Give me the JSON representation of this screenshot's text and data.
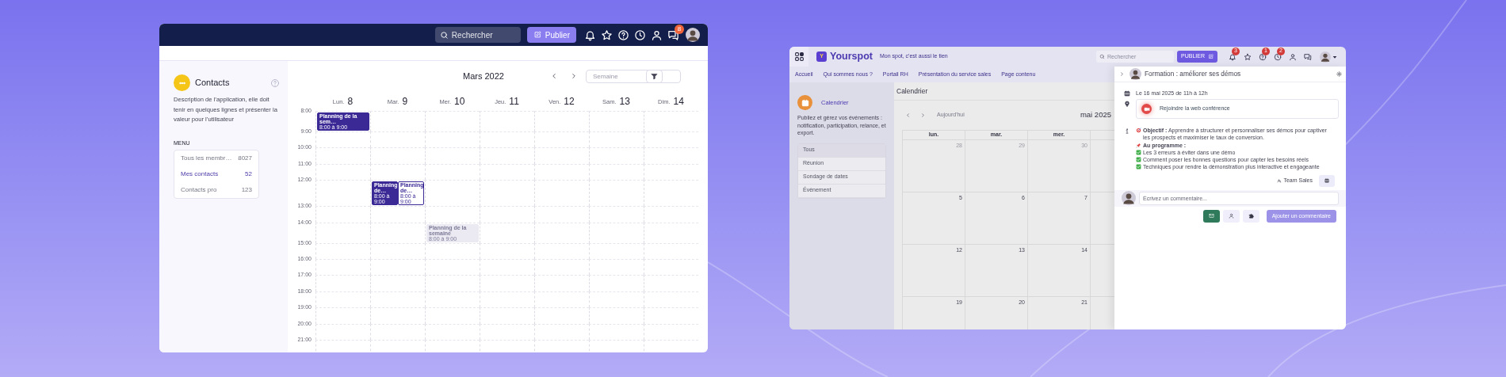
{
  "left_window": {
    "toolbar": [
      {
        "kind": "bell"
      },
      {
        "kind": "star"
      },
      {
        "kind": "help"
      },
      {
        "kind": "clock"
      },
      {
        "kind": "user"
      },
      {
        "kind": "chat",
        "badge": "8"
      }
    ],
    "search_placeholder": "Rechercher",
    "publish_label": "Publier",
    "sidebar": {
      "title": "Contacts",
      "description": "Description de l’application, elle doit tenir en quelques lignes et présenter la valeur pour l’utilisateur",
      "menu_heading": "MENU",
      "menu": [
        {
          "label": "Tous les membr…",
          "count": "8027",
          "selected": false
        },
        {
          "label": "Mes contacts",
          "count": "52",
          "selected": true
        },
        {
          "label": "Contacts pro",
          "count": "123",
          "selected": false
        }
      ]
    },
    "calendar": {
      "title": "Mars 2022",
      "view_placeholder": "Semaine",
      "days": [
        {
          "name": "Lun.",
          "date": "8"
        },
        {
          "name": "Mar.",
          "date": "9"
        },
        {
          "name": "Mer.",
          "date": "10"
        },
        {
          "name": "Jeu.",
          "date": "11"
        },
        {
          "name": "Ven.",
          "date": "12"
        },
        {
          "name": "Sam.",
          "date": "13"
        },
        {
          "name": "Dim.",
          "date": "14"
        }
      ],
      "hours": [
        {
          "label": "8:00",
          "cells": [
            {
              "events": [
                {
                  "kind": "solid",
                  "title": "Planning de la sem…",
                  "time": "8:00 à 9:00"
                }
              ]
            }
          ]
        },
        {
          "label": "9:00"
        },
        {
          "label": "10:00"
        },
        {
          "label": "11:00"
        },
        {
          "label": "12:00",
          "cells": [
            {},
            {
              "events": [
                {
                  "kind": "solid",
                  "title": "Planning de…",
                  "time": "8:00 à 9:00"
                },
                {
                  "kind": "outline",
                  "title": "Planning de…",
                  "time": "8:00 à 9:00"
                }
              ]
            }
          ]
        },
        {
          "label": "13:00"
        },
        {
          "label": "14:00",
          "cells": [
            {},
            {},
            {
              "events": [
                {
                  "kind": "faded",
                  "title": "Planning de la semaine",
                  "time": "8:00 à 9:00"
                }
              ]
            }
          ]
        },
        {
          "label": "15:00"
        },
        {
          "label": "16:00"
        },
        {
          "label": "17:00"
        },
        {
          "label": "18:00"
        },
        {
          "label": "19:00"
        },
        {
          "label": "20:00"
        },
        {
          "label": "21:00"
        }
      ]
    }
  },
  "right_window": {
    "logo_letter": "Y",
    "brand": "Yourspot",
    "tagline": "Mon spot, c'est aussi le tien",
    "search_placeholder": "Rechercher",
    "publish_label": "PUBLIER",
    "toolbar": [
      {
        "kind": "bell",
        "badge": "3"
      },
      {
        "kind": "star"
      },
      {
        "kind": "help",
        "badge": "1"
      },
      {
        "kind": "clock",
        "badge": "2"
      },
      {
        "kind": "user"
      },
      {
        "kind": "chat"
      }
    ],
    "nav": [
      "Accueil",
      "Qui sommes nous ?",
      "Portail RH",
      "Présentation du service sales",
      "Page contenu"
    ],
    "sidebar": {
      "title": "Calendrier",
      "description": "Publiez et gérez vos événements : notification, participation, relance, et export.",
      "filters": [
        {
          "label": "Tous",
          "selected": true
        },
        {
          "label": "Réunion",
          "selected": false
        },
        {
          "label": "Sondage de dates",
          "selected": false
        },
        {
          "label": "Évènement",
          "selected": false
        }
      ]
    },
    "calendar": {
      "heading": "Calendrier",
      "today_label": "Aujourd'hui",
      "title": "mai 2025",
      "weekdays": [
        "lun.",
        "mar.",
        "mer."
      ],
      "weeks": [
        {
          "days": [
            {
              "date": "28",
              "outside": true
            },
            {
              "date": "29",
              "outside": true
            },
            {
              "date": "30",
              "outside": true
            }
          ]
        },
        {
          "days": [
            {
              "date": "5",
              "outside": false
            },
            {
              "date": "6",
              "outside": false
            },
            {
              "date": "7",
              "outside": false
            }
          ]
        },
        {
          "days": [
            {
              "date": "12",
              "outside": false
            },
            {
              "date": "13",
              "outside": false
            },
            {
              "date": "14",
              "outside": false
            }
          ]
        },
        {
          "days": [
            {
              "date": "19",
              "outside": false
            },
            {
              "date": "20",
              "outside": false
            },
            {
              "date": "21",
              "outside": false
            }
          ]
        }
      ]
    },
    "event_panel": {
      "title": "Formation : améliorer ses démos",
      "date": "Le 16 mai 2025 de 11h à 12h",
      "join_label": "Rejoindre la web conférence",
      "description": [
        {
          "kind": "objective",
          "text": "**Objectif :** Apprendre à structurer et personnaliser ses démos pour captiver les prospects et maximiser le taux de conversion."
        },
        {
          "kind": "program",
          "text": "**Au programme :**"
        },
        {
          "kind": "check",
          "text": "Les 3 erreurs à éviter dans une démo"
        },
        {
          "kind": "check",
          "text": "Comment poser les bonnes questions pour capter les besoins réels"
        },
        {
          "kind": "check",
          "text": "Techniques pour rendre la démonstration plus interactive et engageante"
        }
      ],
      "group": "Team Sales",
      "comment_placeholder": "Écrivez un commentaire...",
      "submit_label": "Ajouter un commentaire"
    }
  }
}
